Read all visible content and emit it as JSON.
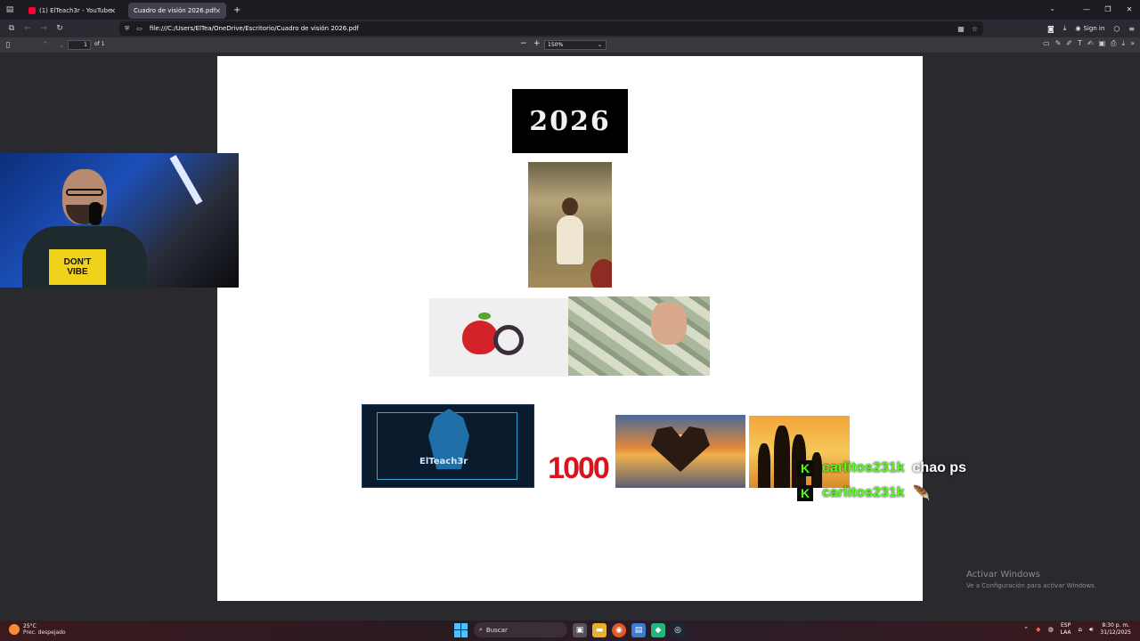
{
  "browser": {
    "tabs": [
      {
        "label": "(1) ElTeach3r - YouTube",
        "active": false
      },
      {
        "label": "Cuadro de visión 2026.pdf",
        "active": true
      }
    ],
    "url": "file:///C:/Users/ElTea/OneDrive/Escritorio/Cuadro de visión 2026.pdf",
    "sign_in": "Sign in"
  },
  "pdf_toolbar": {
    "page_number": "1",
    "page_count": "of 1",
    "zoom": "150%"
  },
  "document": {
    "year_banner": "2026",
    "thousand_text": "1000",
    "wolf_logo_text": "ElTeach3r"
  },
  "webcam": {
    "shirt_line1": "DON'T",
    "shirt_line2": "VIBE"
  },
  "chat": {
    "messages": [
      {
        "badge": "K",
        "user": "carlitos231k",
        "text": "chao ps"
      },
      {
        "badge": "K",
        "user": "carlitos231k",
        "text": "🪶"
      }
    ]
  },
  "watermark": {
    "title": "Activar Windows",
    "subtitle": "Ve a Configuración para activar Windows."
  },
  "taskbar": {
    "temp": "25°C",
    "condition": "Prec. despejado",
    "search_label": "Buscar",
    "lang1": "ESP",
    "lang2": "LAA",
    "time": "8:30 p. m.",
    "date": "31/12/2025"
  },
  "colors": {
    "chat_username": "#53fc18",
    "browser_bg": "#2b2a33",
    "thousand_red": "#d9141c"
  }
}
